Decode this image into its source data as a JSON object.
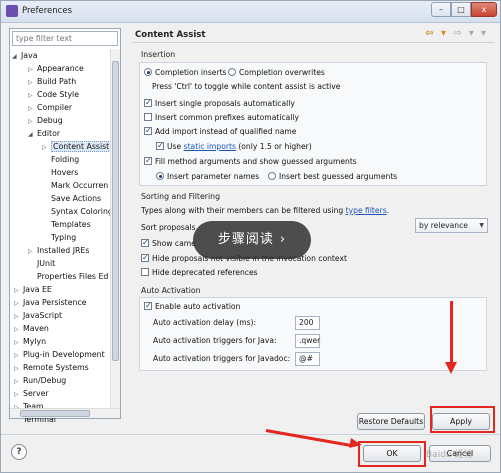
{
  "window": {
    "title": "Preferences"
  },
  "window_buttons": {
    "minimize": "–",
    "maximize": "□",
    "close": "x"
  },
  "filter": {
    "placeholder": "type filter text"
  },
  "tree": [
    {
      "label": "Java",
      "twisty": "◢"
    },
    {
      "label": "Appearance",
      "twisty": "▷"
    },
    {
      "label": "Build Path",
      "twisty": "▷"
    },
    {
      "label": "Code Style",
      "twisty": "▷"
    },
    {
      "label": "Compiler",
      "twisty": "▷"
    },
    {
      "label": "Debug",
      "twisty": "▷"
    },
    {
      "label": "Editor",
      "twisty": "◢"
    },
    {
      "label": "Content Assist",
      "twisty": "▷"
    },
    {
      "label": "Folding",
      "twisty": ""
    },
    {
      "label": "Hovers",
      "twisty": ""
    },
    {
      "label": "Mark Occurren",
      "twisty": ""
    },
    {
      "label": "Save Actions",
      "twisty": ""
    },
    {
      "label": "Syntax Coloring",
      "twisty": ""
    },
    {
      "label": "Templates",
      "twisty": ""
    },
    {
      "label": "Typing",
      "twisty": ""
    },
    {
      "label": "Installed JREs",
      "twisty": "▷"
    },
    {
      "label": "JUnit",
      "twisty": ""
    },
    {
      "label": "Properties Files Ed",
      "twisty": ""
    },
    {
      "label": "Java EE",
      "twisty": "▷"
    },
    {
      "label": "Java Persistence",
      "twisty": "▷"
    },
    {
      "label": "JavaScript",
      "twisty": "▷"
    },
    {
      "label": "Maven",
      "twisty": "▷"
    },
    {
      "label": "Mylyn",
      "twisty": "▷"
    },
    {
      "label": "Plug-in Development",
      "twisty": "▷"
    },
    {
      "label": "Remote Systems",
      "twisty": "▷"
    },
    {
      "label": "Run/Debug",
      "twisty": "▷"
    },
    {
      "label": "Server",
      "twisty": "▷"
    },
    {
      "label": "Team",
      "twisty": "▷"
    },
    {
      "label": "Terminal",
      "twisty": ""
    }
  ],
  "page": {
    "title": "Content Assist",
    "nav_back": "⇦ ▾",
    "nav_forward": "⇨ ▾",
    "nav_menu": "▾"
  },
  "insertion": {
    "label": "Insertion",
    "completion_inserts": "Completion inserts",
    "completion_overwrites": "Completion overwrites",
    "toggle_hint": "Press 'Ctrl' to toggle while content assist is active",
    "insert_single": "Insert single proposals automatically",
    "insert_common_prefixes": "Insert common prefixes automatically",
    "add_import": "Add import instead of qualified name",
    "use_prefix": "Use",
    "static_imports_link": "static imports",
    "use_suffix": "(only 1.5 or higher)",
    "fill_args": "Fill method arguments and show guessed arguments",
    "insert_param_names": "Insert parameter names",
    "insert_best_guessed": "Insert best guessed arguments"
  },
  "sorting": {
    "label": "Sorting and Filtering",
    "types_text": "Types along with their members can be filtered using",
    "type_filters_link": "type filters",
    "types_suffix": ".",
    "sort_proposals": "Sort proposals",
    "sort_value": "by relevance",
    "show_camel": "Show came",
    "hide_proposals": "Hide proposals not visible in the invocation context",
    "hide_deprecated": "Hide deprecated references"
  },
  "auto_activation": {
    "label": "Auto Activation",
    "enable": "Enable auto activation",
    "delay_label": "Auto activation delay (ms):",
    "delay_value": "200",
    "java_triggers_label": "Auto activation triggers for Java:",
    "java_triggers_value": ".qwer",
    "javadoc_triggers_label": "Auto activation triggers for Javadoc:",
    "javadoc_triggers_value": "@#"
  },
  "buttons": {
    "restore_defaults": "Restore Defaults",
    "apply": "Apply",
    "ok": "OK",
    "cancel": "Cancel",
    "help": "?"
  },
  "overlay": {
    "text": "步骤阅读",
    "chevron": "›"
  },
  "watermark": "Baidu 经验",
  "colors": {
    "annotation": "#e3261f",
    "link": "#1a55b7",
    "selection": "#dce8f6"
  }
}
